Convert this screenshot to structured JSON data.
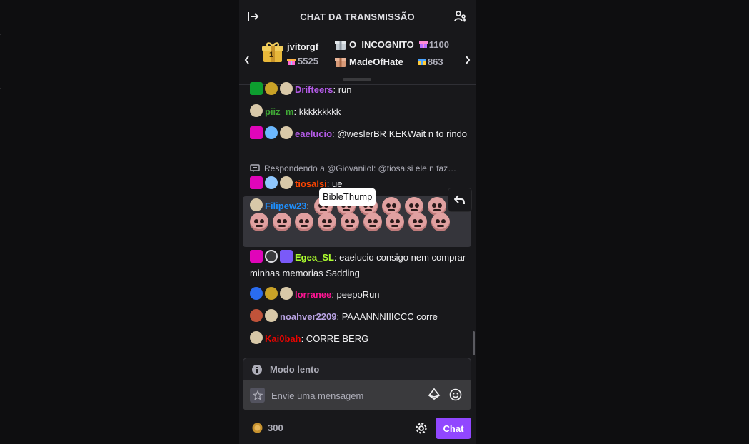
{
  "colors": {
    "background": "#0e0e10",
    "panel": "#18181b",
    "accent": "#9147ff",
    "tooltip_bg": "#ffffff"
  },
  "header": {
    "title": "CHAT DA TRANSMISSÃO",
    "collapse_icon": "collapse-right-icon",
    "users_icon": "community-icon"
  },
  "leaderboard": {
    "first": {
      "rank": "1",
      "name": "jvitorgf",
      "score": "5525"
    },
    "others": [
      {
        "rank": "2",
        "name": "O_INCOGNITO",
        "score": "1100"
      },
      {
        "rank": "3",
        "name": "MadeOfHate",
        "score": "863"
      }
    ]
  },
  "messages": [
    {
      "user": "Drifteers",
      "color": "#b45be8",
      "text": ": run"
    },
    {
      "user": "piiz_m",
      "color": "#40a936",
      "text": ": kkkkkkkkk"
    },
    {
      "user": "eaelucio",
      "color": "#b45be8",
      "text": ": @weslerBR KEKWait n to rindo"
    },
    {
      "user": "tiosalsi",
      "color": "#ff4500",
      "text": ": ue"
    },
    {
      "user": "Filipew23",
      "color": "#1e90ff",
      "text": ":"
    },
    {
      "user": "Egea_SL",
      "color": "#adff2f",
      "text": ": eaelucio consigo nem comprar minhas memorias Sadding"
    },
    {
      "user": "lorranee",
      "color": "#ff1493",
      "text": ": peepoRun"
    },
    {
      "user": "noahver2209",
      "color": "#b9a3e3",
      "text": ": PAAANNNIIICCC corre"
    },
    {
      "user": "Kai0bah",
      "color": "#eb0400",
      "text": ": CORRE BERG"
    }
  ],
  "reply_context": "Respondendo a @Giovanilol: @tiosalsi ele n faz…",
  "emote_tooltip": "BibleThump",
  "emote_count": 15,
  "slow_mode": "Modo lento",
  "input": {
    "placeholder": "Envie uma mensagem"
  },
  "footer": {
    "points": "300",
    "chat_button": "Chat"
  }
}
